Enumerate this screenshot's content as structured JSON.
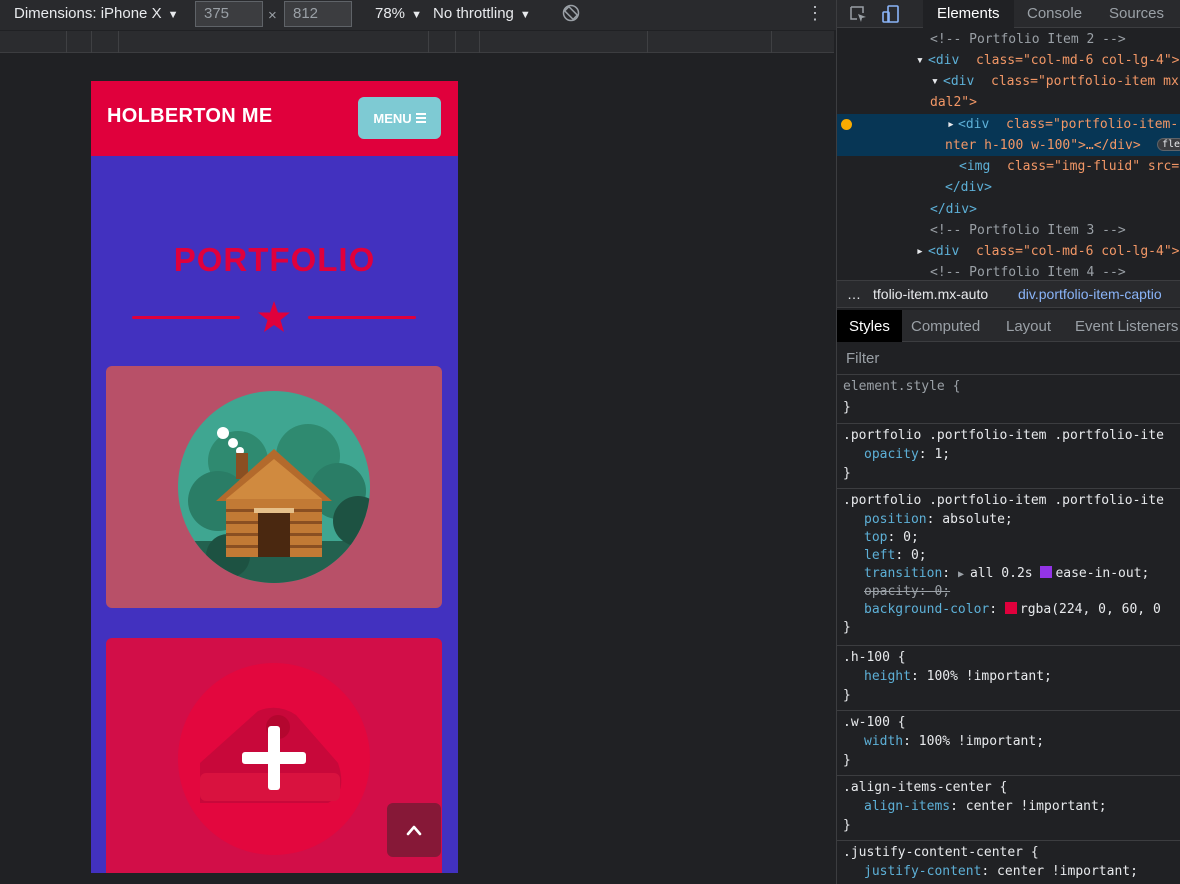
{
  "toolbar": {
    "dimensions": "Dimensions: iPhone X",
    "width": "375",
    "times": "×",
    "height": "812",
    "zoom": "78%",
    "throttling": "No throttling"
  },
  "site": {
    "brand": "HOLBERTON ME",
    "menu_label": "MENU",
    "portfolio_title": "PORTFOLIO"
  },
  "devtools": {
    "tabs": [
      "Elements",
      "Console",
      "Sources"
    ],
    "dom": [
      "<!-- Portfolio Item 2 -->",
      "class=\"col-md-6 col-lg-4\">",
      "class=\"portfolio-item mx",
      "dal2\">",
      "class=\"portfolio-item-",
      "nter h-100 w-100\">…</div>",
      "fle",
      "class=\"img-fluid\" src=",
      "</div>",
      "</div>",
      "<!-- Portfolio Item 3 -->",
      "class=\"col-md-6 col-lg-4\">",
      "<!-- Portfolio Item 4 -->"
    ],
    "breadcrumbs": [
      "…",
      "tfolio-item.mx-auto",
      "div.portfolio-item-captio"
    ],
    "style_tabs": [
      "Styles",
      "Computed",
      "Layout",
      "Event Listeners"
    ],
    "filter_placeholder": "Filter",
    "styles": {
      "r0_sel": "element.style {",
      "r1_sel": ".portfolio .portfolio-item .portfolio-ite",
      "r1_p1": "opacity",
      "r1_v1": ": 1;",
      "r2_sel": ".portfolio .portfolio-item .portfolio-ite",
      "r2_p1": "position",
      "r2_v1": ": absolute;",
      "r2_p2": "top",
      "r2_v2": ": 0;",
      "r2_p3": "left",
      "r2_v3": ": 0;",
      "r2_p4": "transition",
      "r2_v4a": ": ",
      "r2_v4b": "all 0.2s ",
      "r2_v4c": "ease-in-out;",
      "r2_p5": "opacity: 0;",
      "r2_p6": "background-color",
      "r2_v6": "rgba(224, 0, 60, 0",
      "r3_sel": ".h-100 {",
      "r3_p": "height",
      "r3_v": ": 100% !important;",
      "r4_sel": ".w-100 {",
      "r4_p": "width",
      "r4_v": ": 100% !important;",
      "r5_sel": ".align-items-center {",
      "r5_p": "align-items",
      "r5_v": ": center !important;",
      "r6_sel": ".justify-content-center {",
      "r6_p": "justify-content",
      "r6_v": ": center !important;",
      "close": "}"
    }
  },
  "colors": {
    "brand_red": "#e0003c",
    "phone_bg": "#4231bf",
    "menu_teal": "#7ecad3"
  }
}
